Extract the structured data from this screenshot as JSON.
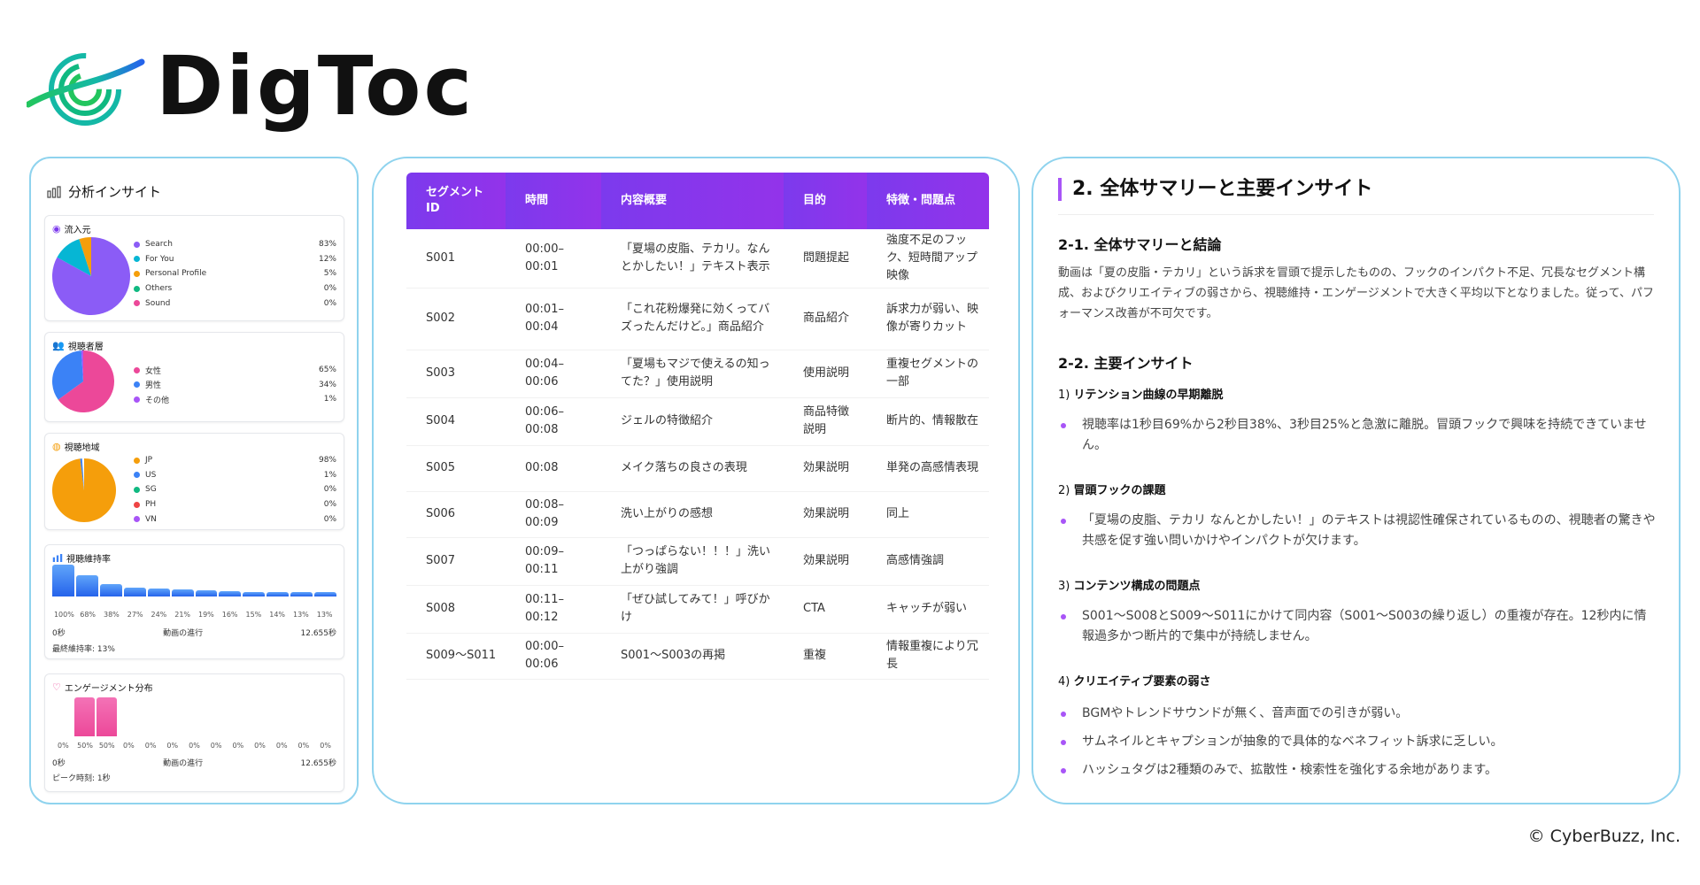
{
  "logo": {
    "wordmark": "DigToc"
  },
  "left": {
    "title": "分析インサイト",
    "traffic": {
      "title": "流入元",
      "items": [
        {
          "label": "Search",
          "value": "83%",
          "color": "#8b5cf6",
          "share": 83
        },
        {
          "label": "For You",
          "value": "12%",
          "color": "#06b6d4",
          "share": 12
        },
        {
          "label": "Personal Profile",
          "value": "5%",
          "color": "#f59e0b",
          "share": 5
        },
        {
          "label": "Others",
          "value": "0%",
          "color": "#10b981",
          "share": 0
        },
        {
          "label": "Sound",
          "value": "0%",
          "color": "#ec4899",
          "share": 0
        }
      ]
    },
    "audience": {
      "title": "視聴者層",
      "items": [
        {
          "label": "女性",
          "value": "65%",
          "color": "#ec4899",
          "share": 65
        },
        {
          "label": "男性",
          "value": "34%",
          "color": "#3b82f6",
          "share": 34
        },
        {
          "label": "その他",
          "value": "1%",
          "color": "#a855f7",
          "share": 1
        }
      ]
    },
    "region": {
      "title": "視聴地域",
      "items": [
        {
          "label": "JP",
          "value": "98%",
          "color": "#f59e0b",
          "share": 98
        },
        {
          "label": "US",
          "value": "1%",
          "color": "#3b82f6",
          "share": 1
        },
        {
          "label": "SG",
          "value": "0%",
          "color": "#10b981",
          "share": 0
        },
        {
          "label": "PH",
          "value": "0%",
          "color": "#ef4444",
          "share": 0
        },
        {
          "label": "VN",
          "value": "0%",
          "color": "#a855f7",
          "share": 0
        }
      ]
    },
    "retention": {
      "title": "視聴維持率",
      "values": [
        100,
        68,
        38,
        27,
        24,
        21,
        19,
        16,
        15,
        14,
        13,
        13
      ],
      "labels": [
        "100%",
        "68%",
        "38%",
        "27%",
        "24%",
        "21%",
        "19%",
        "16%",
        "15%",
        "14%",
        "13%",
        "13%"
      ],
      "axis_start": "0秒",
      "axis_mid": "動画の進行",
      "axis_end": "12.655秒",
      "footer": "最終維持率: 13%"
    },
    "engagement": {
      "title": "エンゲージメント分布",
      "values": [
        0,
        50,
        50,
        0,
        0,
        0,
        0,
        0,
        0,
        0,
        0,
        0,
        0
      ],
      "labels": [
        "0%",
        "50%",
        "50%",
        "0%",
        "0%",
        "0%",
        "0%",
        "0%",
        "0%",
        "0%",
        "0%",
        "0%",
        "0%"
      ],
      "axis_start": "0秒",
      "axis_mid": "動画の進行",
      "axis_end": "12.655秒",
      "footer": "ピーク時刻: 1秒"
    }
  },
  "table": {
    "headers": [
      "セグメントID",
      "時間",
      "内容概要",
      "目的",
      "特徴・問題点"
    ],
    "rows": [
      [
        "S001",
        "00:00–00:01",
        "「夏場の皮脂、テカリ。なんとかしたい！」テキスト表示",
        "問題提起",
        "強度不足のフック、短時間アップ映像"
      ],
      [
        "S002",
        "00:01–00:04",
        "「これ花粉爆発に効くってバズったんだけど。」商品紹介",
        "商品紹介",
        "訴求力が弱い、映像が寄りカット"
      ],
      [
        "S003",
        "00:04–00:06",
        "「夏場もマジで使えるの知ってた？」使用説明",
        "使用説明",
        "重複セグメントの一部"
      ],
      [
        "S004",
        "00:06–00:08",
        "ジェルの特徴紹介",
        "商品特徴説明",
        "断片的、情報散在"
      ],
      [
        "S005",
        "00:08",
        "メイク落ちの良さの表現",
        "効果説明",
        "単発の高感情表現"
      ],
      [
        "S006",
        "00:08–00:09",
        "洗い上がりの感想",
        "効果説明",
        "同上"
      ],
      [
        "S007",
        "00:09–00:11",
        "「つっぱらない！！！」洗い上がり強調",
        "効果説明",
        "高感情強調"
      ],
      [
        "S008",
        "00:11–00:12",
        "「ぜひ試してみて！」呼びかけ",
        "CTA",
        "キャッチが弱い"
      ],
      [
        "S009〜S011",
        "00:00–00:06",
        "S001〜S003の再掲",
        "重複",
        "情報重複により冗長"
      ]
    ]
  },
  "summary": {
    "title": "2. 全体サマリーと主要インサイト",
    "s1_title": "2-1. 全体サマリーと結論",
    "s1_text": "動画は「夏の皮脂・テカリ」という訴求を冒頭で提示したものの、フックのインパクト不足、冗長なセグメント構成、およびクリエイティブの弱さから、視聴維持・エンゲージメントで大きく平均以下となりました。従って、パフォーマンス改善が不可欠です。",
    "s2_title": "2-2. 主要インサイト",
    "insights": [
      {
        "num": "1)",
        "title": "リテンション曲線の早期離脱",
        "bullets": [
          "視聴率は1秒目69%から2秒目38%、3秒目25%と急激に離脱。冒頭フックで興味を持続できていません。"
        ]
      },
      {
        "num": "2)",
        "title": "冒頭フックの課題",
        "bullets": [
          "「夏場の皮脂、テカリ なんとかしたい！」のテキストは視認性確保されているものの、視聴者の驚きや共感を促す強い問いかけやインパクトが欠けます。"
        ]
      },
      {
        "num": "3)",
        "title": "コンテンツ構成の問題点",
        "bullets": [
          "S001〜S008とS009〜S011にかけて同内容（S001〜S003の繰り返し）の重複が存在。12秒内に情報過多かつ断片的で集中が持続しません。"
        ]
      },
      {
        "num": "4)",
        "title": "クリエイティブ要素の弱さ",
        "bullets": [
          "BGMやトレンドサウンドが無く、音声面での引きが弱い。",
          "サムネイルとキャプションが抽象的で具体的なベネフィット訴求に乏しい。",
          "ハッシュタグは2種類のみで、拡散性・検索性を強化する余地があります。"
        ]
      }
    ]
  },
  "copyright": "© CyberBuzz, Inc."
}
